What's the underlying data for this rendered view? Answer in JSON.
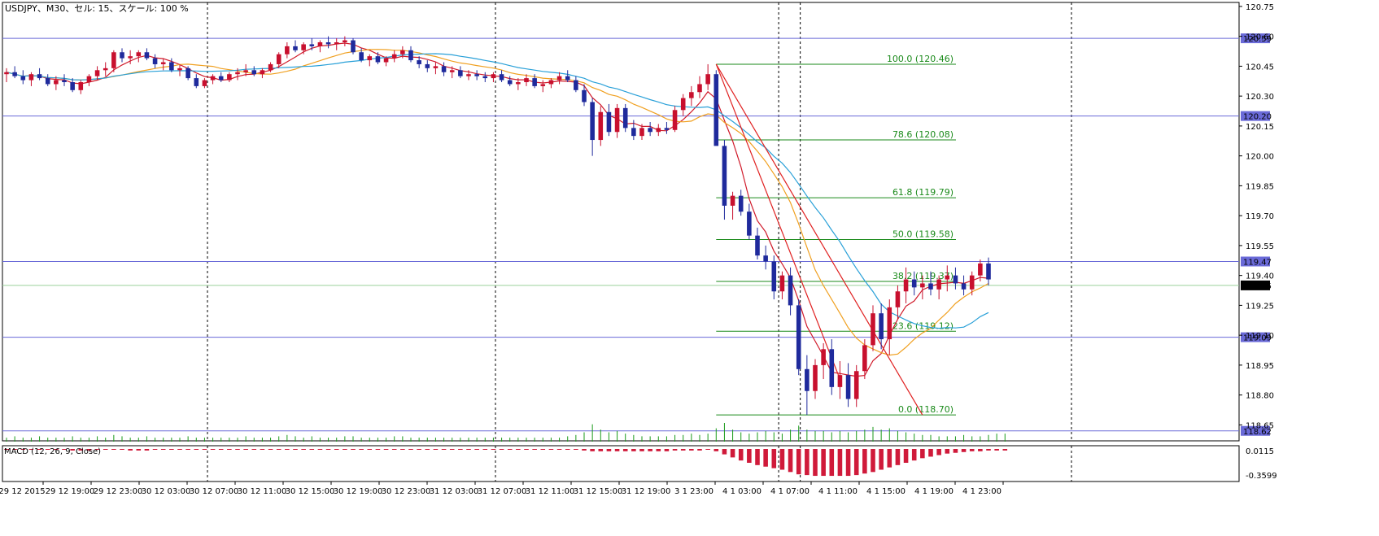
{
  "header": {
    "title": "USDJPY、M30、セル: 15、スケール: 100 %"
  },
  "macd": {
    "label": "MACD (12, 26, 9, Close)",
    "levels": [
      "0.0115",
      "-0.3599"
    ]
  },
  "colors": {
    "bull": "#c8102e",
    "bear": "#1f2a9c",
    "ma_fast": "#d01a2a",
    "ma_mid": "#f0a020",
    "ma_slow": "#29a0d8",
    "hline": "#6a6ad8",
    "fib": "#1a8a1a",
    "volume": "#1a9a1a",
    "macd_hist": "#d01a3a"
  },
  "chart_data": {
    "type": "candlestick",
    "symbol": "USDJPY",
    "timeframe": "M30",
    "ylim": [
      118.57,
      120.77
    ],
    "y_ticks": [
      "120.75",
      "120.60",
      "120.45",
      "120.30",
      "120.15",
      "120.00",
      "119.85",
      "119.70",
      "119.55",
      "119.40",
      "119.25",
      "119.10",
      "118.95",
      "118.80",
      "118.65"
    ],
    "x_labels": [
      "29 12 2015",
      "29 12 19:00",
      "29 12 23:00",
      "30 12 03:00",
      "30 12 07:00",
      "30 12 11:00",
      "30 12 15:00",
      "30 12 19:00",
      "30 12 23:00",
      "31 12 03:00",
      "31 12 07:00",
      "31 12 11:00",
      "31 12 15:00",
      "31 12 19:00",
      "3 1 23:00",
      "4 1 03:00",
      "4 1 07:00",
      "4 1 11:00",
      "4 1 15:00",
      "4 1 19:00",
      "4 1 23:00"
    ],
    "period_separators_at_label_index": [
      2,
      8,
      13.9,
      14.35,
      20
    ],
    "horizontal_levels": [
      {
        "value": 120.59,
        "label": "120.59"
      },
      {
        "value": 120.2,
        "label": "120.20"
      },
      {
        "value": 119.47,
        "label": "119.47"
      },
      {
        "value": 119.09,
        "label": "119.09"
      },
      {
        "value": 118.62,
        "label": "118.62"
      }
    ],
    "bid_line": {
      "value": 119.35,
      "label": "119.35"
    },
    "fibonacci": [
      {
        "label": "100.0 (120.46)",
        "value": 120.46
      },
      {
        "label": "78.6 (120.08)",
        "value": 120.08
      },
      {
        "label": "61.8 (119.79)",
        "value": 119.79
      },
      {
        "label": "50.0 (119.58)",
        "value": 119.58
      },
      {
        "label": "38.2 (119.37)",
        "value": 119.37
      },
      {
        "label": "23.6 (119.12)",
        "value": 119.12
      },
      {
        "label": "0.0 (118.70)",
        "value": 118.7
      }
    ],
    "candles": [
      [
        120.41,
        120.44,
        120.37,
        120.42
      ],
      [
        120.42,
        120.45,
        120.39,
        120.4
      ],
      [
        120.4,
        120.43,
        120.36,
        120.38
      ],
      [
        120.38,
        120.42,
        120.35,
        120.41
      ],
      [
        120.41,
        120.44,
        120.38,
        120.39
      ],
      [
        120.39,
        120.41,
        120.35,
        120.36
      ],
      [
        120.36,
        120.4,
        120.33,
        120.38
      ],
      [
        120.38,
        120.41,
        120.35,
        120.37
      ],
      [
        120.37,
        120.39,
        120.32,
        120.33
      ],
      [
        120.33,
        120.38,
        120.31,
        120.37
      ],
      [
        120.37,
        120.41,
        120.35,
        120.4
      ],
      [
        120.4,
        120.45,
        120.38,
        120.43
      ],
      [
        120.43,
        120.47,
        120.4,
        120.44
      ],
      [
        120.44,
        120.53,
        120.42,
        120.52
      ],
      [
        120.52,
        120.54,
        120.47,
        120.49
      ],
      [
        120.49,
        120.53,
        120.46,
        120.5
      ],
      [
        120.5,
        120.53,
        120.47,
        120.52
      ],
      [
        120.52,
        120.54,
        120.48,
        120.49
      ],
      [
        120.49,
        120.51,
        120.44,
        120.46
      ],
      [
        120.46,
        120.49,
        120.43,
        120.47
      ],
      [
        120.47,
        120.49,
        120.42,
        120.43
      ],
      [
        120.43,
        120.46,
        120.4,
        120.44
      ],
      [
        120.44,
        120.45,
        120.38,
        120.39
      ],
      [
        120.39,
        120.41,
        120.34,
        120.35
      ],
      [
        120.35,
        120.39,
        120.34,
        120.38
      ],
      [
        120.38,
        120.41,
        120.36,
        120.4
      ],
      [
        120.4,
        120.42,
        120.37,
        120.38
      ],
      [
        120.38,
        120.42,
        120.37,
        120.41
      ],
      [
        120.41,
        120.44,
        120.38,
        120.42
      ],
      [
        120.42,
        120.46,
        120.4,
        120.43
      ],
      [
        120.43,
        120.45,
        120.4,
        120.41
      ],
      [
        120.41,
        120.44,
        120.39,
        120.43
      ],
      [
        120.43,
        120.47,
        120.42,
        120.46
      ],
      [
        120.46,
        120.52,
        120.44,
        120.51
      ],
      [
        120.51,
        120.57,
        120.49,
        120.55
      ],
      [
        120.55,
        120.58,
        120.52,
        120.53
      ],
      [
        120.53,
        120.57,
        120.51,
        120.56
      ],
      [
        120.56,
        120.59,
        120.53,
        120.55
      ],
      [
        120.55,
        120.58,
        120.52,
        120.57
      ],
      [
        120.57,
        120.6,
        120.54,
        120.56
      ],
      [
        120.56,
        120.59,
        120.53,
        120.57
      ],
      [
        120.57,
        120.6,
        120.55,
        120.58
      ],
      [
        120.58,
        120.59,
        120.51,
        120.52
      ],
      [
        120.52,
        120.54,
        120.47,
        120.48
      ],
      [
        120.48,
        120.51,
        120.45,
        120.5
      ],
      [
        120.5,
        120.52,
        120.46,
        120.47
      ],
      [
        120.47,
        120.5,
        120.45,
        120.49
      ],
      [
        120.49,
        120.53,
        120.47,
        120.51
      ],
      [
        120.51,
        120.55,
        120.49,
        120.53
      ],
      [
        120.53,
        120.55,
        120.47,
        120.48
      ],
      [
        120.48,
        120.5,
        120.44,
        120.46
      ],
      [
        120.46,
        120.48,
        120.42,
        120.44
      ],
      [
        120.44,
        120.47,
        120.41,
        120.45
      ],
      [
        120.45,
        120.47,
        120.4,
        120.42
      ],
      [
        120.42,
        120.45,
        120.39,
        120.43
      ],
      [
        120.43,
        120.45,
        120.39,
        120.4
      ],
      [
        120.4,
        120.43,
        120.38,
        120.41
      ],
      [
        120.41,
        120.43,
        120.38,
        120.4
      ],
      [
        120.4,
        120.42,
        120.37,
        120.39
      ],
      [
        120.39,
        120.42,
        120.37,
        120.41
      ],
      [
        120.41,
        120.43,
        120.37,
        120.38
      ],
      [
        120.38,
        120.4,
        120.35,
        120.36
      ],
      [
        120.36,
        120.39,
        120.33,
        120.37
      ],
      [
        120.37,
        120.41,
        120.35,
        120.39
      ],
      [
        120.39,
        120.41,
        120.34,
        120.35
      ],
      [
        120.35,
        120.38,
        120.32,
        120.36
      ],
      [
        120.36,
        120.39,
        120.34,
        120.38
      ],
      [
        120.38,
        120.42,
        120.36,
        120.4
      ],
      [
        120.4,
        120.43,
        120.37,
        120.38
      ],
      [
        120.38,
        120.4,
        120.32,
        120.33
      ],
      [
        120.33,
        120.36,
        120.25,
        120.27
      ],
      [
        120.27,
        120.29,
        120.0,
        120.08
      ],
      [
        120.08,
        120.25,
        120.05,
        120.22
      ],
      [
        120.22,
        120.26,
        120.1,
        120.12
      ],
      [
        120.12,
        120.26,
        120.09,
        120.24
      ],
      [
        120.24,
        120.26,
        120.12,
        120.14
      ],
      [
        120.14,
        120.18,
        120.08,
        120.1
      ],
      [
        120.1,
        120.16,
        120.08,
        120.14
      ],
      [
        120.14,
        120.17,
        120.1,
        120.12
      ],
      [
        120.12,
        120.16,
        120.1,
        120.14
      ],
      [
        120.14,
        120.17,
        120.11,
        120.13
      ],
      [
        120.13,
        120.25,
        120.12,
        120.23
      ],
      [
        120.23,
        120.31,
        120.2,
        120.29
      ],
      [
        120.29,
        120.35,
        120.25,
        120.32
      ],
      [
        120.32,
        120.4,
        120.29,
        120.36
      ],
      [
        120.36,
        120.46,
        120.33,
        120.41
      ],
      [
        120.41,
        120.43,
        120.25,
        120.05
      ],
      [
        120.05,
        120.08,
        119.68,
        119.75
      ],
      [
        119.75,
        119.82,
        119.68,
        119.8
      ],
      [
        119.8,
        119.83,
        119.7,
        119.72
      ],
      [
        119.72,
        119.76,
        119.58,
        119.6
      ],
      [
        119.6,
        119.64,
        119.48,
        119.5
      ],
      [
        119.5,
        119.55,
        119.43,
        119.47
      ],
      [
        119.47,
        119.5,
        119.28,
        119.32
      ],
      [
        119.32,
        119.42,
        119.28,
        119.4
      ],
      [
        119.4,
        119.44,
        119.2,
        119.25
      ],
      [
        119.25,
        119.28,
        118.9,
        118.93
      ],
      [
        118.93,
        119.0,
        118.7,
        118.82
      ],
      [
        118.82,
        118.98,
        118.78,
        118.95
      ],
      [
        118.95,
        119.06,
        118.88,
        119.03
      ],
      [
        119.03,
        119.08,
        118.8,
        118.84
      ],
      [
        118.84,
        118.97,
        118.78,
        118.9
      ],
      [
        118.9,
        118.96,
        118.74,
        118.78
      ],
      [
        118.78,
        118.95,
        118.74,
        118.92
      ],
      [
        118.92,
        119.08,
        118.88,
        119.05
      ],
      [
        119.05,
        119.25,
        119.02,
        119.21
      ],
      [
        119.21,
        119.26,
        119.03,
        119.08
      ],
      [
        119.08,
        119.28,
        119.0,
        119.24
      ],
      [
        119.24,
        119.35,
        119.18,
        119.32
      ],
      [
        119.32,
        119.44,
        119.26,
        119.38
      ],
      [
        119.38,
        119.42,
        119.3,
        119.34
      ],
      [
        119.34,
        119.4,
        119.28,
        119.36
      ],
      [
        119.36,
        119.42,
        119.3,
        119.33
      ],
      [
        119.33,
        119.4,
        119.28,
        119.38
      ],
      [
        119.38,
        119.45,
        119.32,
        119.4
      ],
      [
        119.4,
        119.44,
        119.33,
        119.36
      ],
      [
        119.36,
        119.4,
        119.3,
        119.33
      ],
      [
        119.33,
        119.42,
        119.3,
        119.4
      ],
      [
        119.4,
        119.48,
        119.37,
        119.46
      ],
      [
        119.46,
        119.49,
        119.35,
        119.38
      ]
    ],
    "volumes": [
      3,
      4,
      3,
      3,
      4,
      3,
      3,
      3,
      4,
      3,
      3,
      4,
      3,
      5,
      4,
      3,
      3,
      4,
      3,
      3,
      3,
      3,
      4,
      3,
      3,
      3,
      3,
      3,
      3,
      4,
      3,
      3,
      3,
      4,
      5,
      4,
      3,
      4,
      3,
      3,
      3,
      4,
      4,
      3,
      3,
      3,
      3,
      4,
      4,
      3,
      3,
      3,
      3,
      3,
      3,
      3,
      3,
      3,
      3,
      3,
      3,
      3,
      3,
      3,
      3,
      3,
      3,
      3,
      4,
      5,
      7,
      13,
      9,
      7,
      8,
      6,
      5,
      4,
      4,
      4,
      4,
      5,
      5,
      6,
      5,
      6,
      10,
      14,
      9,
      7,
      6,
      7,
      8,
      7,
      6,
      9,
      12,
      9,
      8,
      8,
      7,
      8,
      7,
      8,
      9,
      11,
      9,
      10,
      8,
      7,
      6,
      5,
      5,
      4,
      4,
      4,
      5,
      4,
      4,
      5,
      6,
      6
    ],
    "macd_hist": [
      0.01,
      0.01,
      0.01,
      0.01,
      0.01,
      0.01,
      0.01,
      0.01,
      0.02,
      0.02,
      0.02,
      0.01,
      0.01,
      0.01,
      0.01,
      0.02,
      0.02,
      0.02,
      0.01,
      0.01,
      0.01,
      0.01,
      0.01,
      0.01,
      0.01,
      0.01,
      0.01,
      0.01,
      0.01,
      0.01,
      0.01,
      0.01,
      0.01,
      0.01,
      0.01,
      0.01,
      0.01,
      0.01,
      0.01,
      0.01,
      0.01,
      0.01,
      0.01,
      0.01,
      0.01,
      0.01,
      0.01,
      0.01,
      0.01,
      0.01,
      0.01,
      0.01,
      0.01,
      0.01,
      0.01,
      0.01,
      0.01,
      0.01,
      0.01,
      0.01,
      0.01,
      0.01,
      0.01,
      0.01,
      0.01,
      0.01,
      0.01,
      0.01,
      0.01,
      0.01,
      0.02,
      0.03,
      0.03,
      0.03,
      0.03,
      0.03,
      0.03,
      0.03,
      0.03,
      0.03,
      0.03,
      0.02,
      0.02,
      0.02,
      0.02,
      0.01,
      0.03,
      0.07,
      0.11,
      0.15,
      0.18,
      0.21,
      0.23,
      0.25,
      0.27,
      0.3,
      0.33,
      0.34,
      0.35,
      0.35,
      0.35,
      0.35,
      0.35,
      0.34,
      0.32,
      0.3,
      0.27,
      0.24,
      0.21,
      0.18,
      0.15,
      0.12,
      0.1,
      0.08,
      0.06,
      0.05,
      0.04,
      0.03,
      0.03,
      0.02,
      0.02,
      0.02
    ],
    "trend_lines": [
      {
        "from": [
          86,
          120.46
        ],
        "to": [
          111,
          118.7
        ]
      },
      {
        "from": [
          86,
          120.46
        ],
        "to": [
          101,
          118.88
        ]
      }
    ]
  }
}
